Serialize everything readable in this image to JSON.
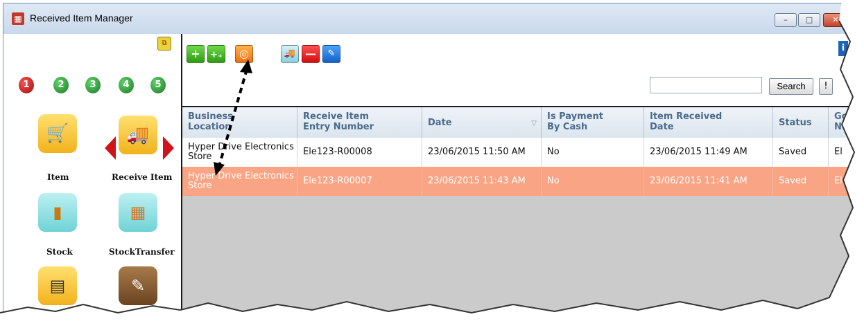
{
  "window": {
    "title": "Received Item Manager",
    "minimize": "–",
    "maximize": "□",
    "close": "✕"
  },
  "left_panel": {
    "toggle_icon": "restore-panels-icon",
    "numbers": [
      {
        "label": "1",
        "color": "#c81414"
      },
      {
        "label": "2",
        "color": "#2a8a2f"
      },
      {
        "label": "3",
        "color": "#2a8a2f"
      },
      {
        "label": "4",
        "color": "#2a8a2f"
      },
      {
        "label": "5",
        "color": "#2a8a2f"
      }
    ],
    "tiles": [
      {
        "label": "Item",
        "icon": "shopping-cart-icon"
      },
      {
        "label": "Receive Item",
        "icon": "delivery-truck-icon"
      },
      {
        "label": "Stock",
        "icon": "hand-trolley-icon"
      },
      {
        "label": "StockTransfer",
        "icon": "stock-transfer-icon"
      },
      {
        "label": "",
        "icon": "cash-register-icon"
      },
      {
        "label": "",
        "icon": "edit-document-icon"
      }
    ]
  },
  "toolbar": {
    "buttons": [
      {
        "name": "add",
        "icon": "plus-icon",
        "glyph": "+"
      },
      {
        "name": "add-multiple",
        "icon": "plus-plus-icon",
        "glyph": "+₊"
      },
      {
        "name": "view",
        "icon": "magnifier-icon",
        "glyph": "◎"
      },
      {
        "name": "receive",
        "icon": "truck-icon",
        "glyph": "🚚"
      },
      {
        "name": "delete",
        "icon": "minus-icon",
        "glyph": "—"
      },
      {
        "name": "edit",
        "icon": "pencil-icon",
        "glyph": "✎"
      }
    ],
    "help_icon": "i",
    "search_value": "",
    "search_button": "Search",
    "extra_button": "!"
  },
  "grid": {
    "columns": [
      "Business Location",
      "Receive Item Entry Number",
      "Date",
      "Is Payment By Cash",
      "Item Received Date",
      "Status",
      "Go N"
    ],
    "sort_column": "Date",
    "sort_indicator": "▽",
    "rows": [
      {
        "business_location": "Hyper Drive Electronics Store",
        "entry_number": "Ele123-R00008",
        "date": "23/06/2015 11:50 AM",
        "is_payment_by_cash": "No",
        "item_received_date": "23/06/2015 11:49 AM",
        "status": "Saved",
        "go": "El",
        "selected": false
      },
      {
        "business_location": "Hyper Drive Electronics Store",
        "entry_number": "Ele123-R00007",
        "date": "23/06/2015 11:43 AM",
        "is_payment_by_cash": "No",
        "item_received_date": "23/06/2015 11:41 AM",
        "status": "Saved",
        "go": "El",
        "selected": true
      }
    ]
  },
  "colors": {
    "selected_row": "#f9a585",
    "header_text": "#4b6b8d",
    "grid_empty": "#cbcbcb"
  }
}
